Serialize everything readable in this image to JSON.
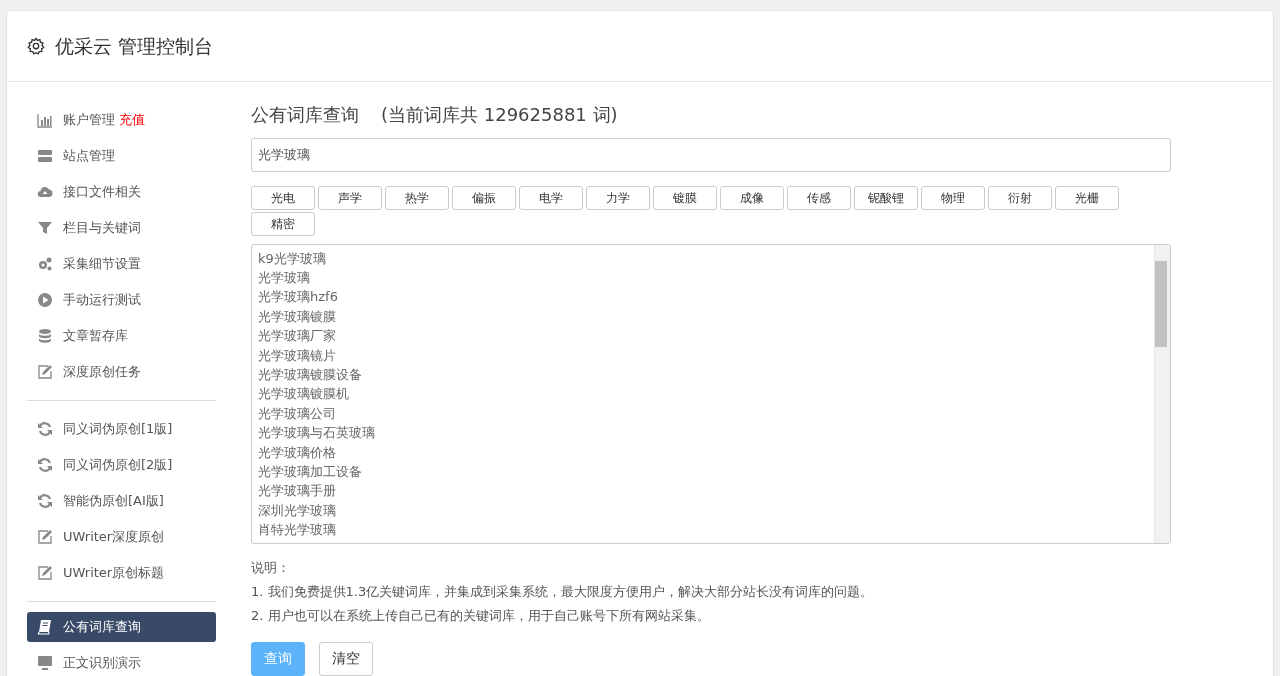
{
  "header": {
    "title": "优采云 管理控制台"
  },
  "sidebar": {
    "groups": [
      [
        {
          "label": "账户管理",
          "badge": "充值",
          "selected": false
        },
        {
          "label": "站点管理",
          "selected": false
        },
        {
          "label": "接口文件相关",
          "selected": false
        },
        {
          "label": "栏目与关键词",
          "selected": false
        },
        {
          "label": "采集细节设置",
          "selected": false
        },
        {
          "label": "手动运行测试",
          "selected": false
        },
        {
          "label": "文章暂存库",
          "selected": false
        },
        {
          "label": "深度原创任务",
          "selected": false
        }
      ],
      [
        {
          "label": "同义词伪原创[1版]",
          "selected": false
        },
        {
          "label": "同义词伪原创[2版]",
          "selected": false
        },
        {
          "label": "智能伪原创[AI版]",
          "selected": false
        },
        {
          "label": "UWriter深度原创",
          "selected": false
        },
        {
          "label": "UWriter原创标题",
          "selected": false
        }
      ],
      [
        {
          "label": "公有词库查询",
          "selected": true
        },
        {
          "label": "正文识别演示",
          "selected": false
        }
      ]
    ]
  },
  "main": {
    "title": "公有词库查询",
    "count_note": "(当前词库共 129625881 词)",
    "search_value": "光学玻璃",
    "tags": [
      "光电",
      "声学",
      "热学",
      "偏振",
      "电学",
      "力学",
      "镀膜",
      "成像",
      "传感",
      "铌酸锂",
      "物理",
      "衍射",
      "光栅",
      "精密"
    ],
    "results": [
      "k9光学玻璃",
      "光学玻璃",
      "光学玻璃hzf6",
      "光学玻璃镀膜",
      "光学玻璃厂家",
      "光学玻璃镜片",
      "光学玻璃镀膜设备",
      "光学玻璃镀膜机",
      "光学玻璃公司",
      "光学玻璃与石英玻璃",
      "光学玻璃价格",
      "光学玻璃加工设备",
      "光学玻璃手册",
      "深圳光学玻璃",
      "肖特光学玻璃"
    ],
    "notes_title": "说明：",
    "notes": [
      "1. 我们免费提供1.3亿关键词库，并集成到采集系统，最大限度方便用户，解决大部分站长没有词库的问题。",
      "2. 用户也可以在系统上传自己已有的关键词库，用于自己账号下所有网站采集。"
    ],
    "buttons": [
      {
        "label": "查询",
        "kind": "primary"
      },
      {
        "label": "清空",
        "kind": "secondary"
      }
    ]
  }
}
